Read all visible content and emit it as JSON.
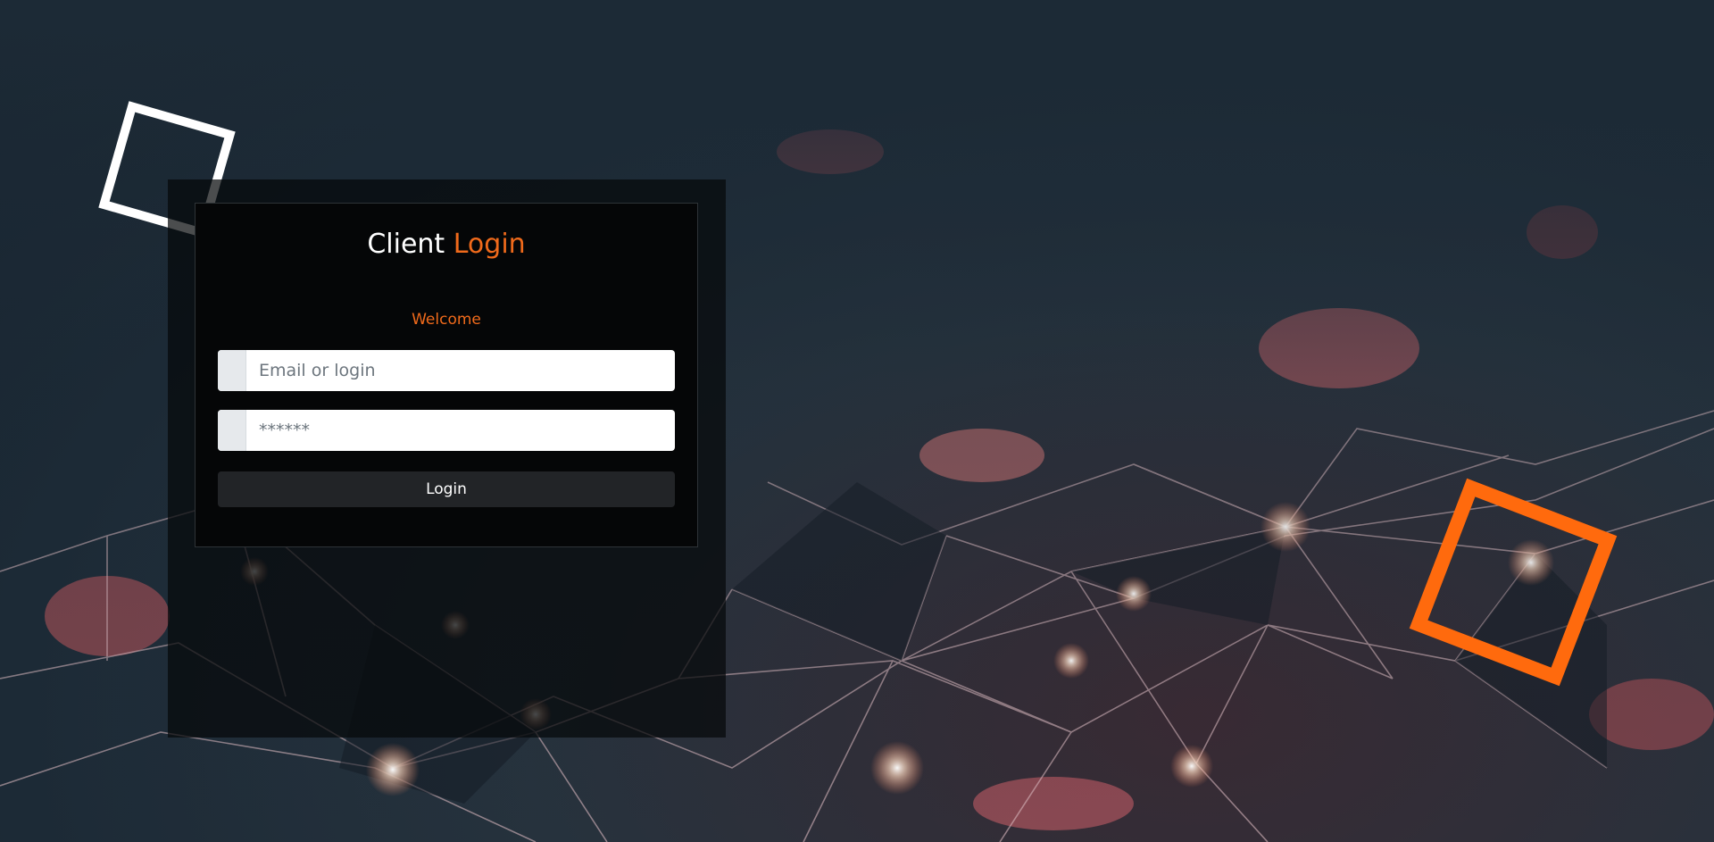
{
  "login": {
    "title_primary": "Client",
    "title_accent": "Login",
    "welcome": "Welcome",
    "email_placeholder": "Email or login",
    "password_placeholder": "******",
    "submit_label": "Login"
  },
  "colors": {
    "accent": "#f06a1b",
    "deco_orange": "#ff6a0d",
    "panel_dark": "#050607",
    "button_bg": "#222427"
  }
}
